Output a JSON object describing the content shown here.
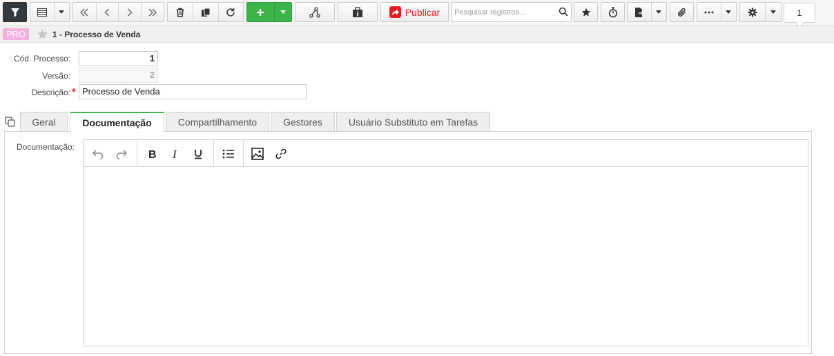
{
  "toolbar": {
    "publish_label": "Publicar",
    "search_placeholder": "Pesquisar registros...",
    "record_counter": "1",
    "icons": [
      "filter-icon",
      "grid-view-icon",
      "chevron-down-icon",
      "first-record-icon",
      "previous-record-icon",
      "next-record-icon",
      "last-record-icon",
      "delete-icon",
      "duplicate-icon",
      "refresh-icon",
      "plus-icon",
      "chevron-down-icon",
      "flowchart-icon",
      "info-card-icon",
      "publish-icon",
      "search-icon",
      "star-icon",
      "stopwatch-icon",
      "export-icon",
      "chevron-down-icon",
      "paperclip-icon",
      "more-icon",
      "chevron-down-icon",
      "gear-icon",
      "chevron-down-icon"
    ]
  },
  "breadcrumb": {
    "badge": "PRO",
    "title": "1 - Processo de Venda"
  },
  "form": {
    "code_label": "Cód. Processo:",
    "code_value": "1",
    "version_label": "Versão:",
    "version_value": "2",
    "description_label": "Descrição:",
    "description_required_mark": "*",
    "description_value": "Processo de Venda"
  },
  "tabs": [
    {
      "label": "Geral",
      "active": false
    },
    {
      "label": "Documentação",
      "active": true
    },
    {
      "label": "Compartilhamento",
      "active": false
    },
    {
      "label": "Gestores",
      "active": false
    },
    {
      "label": "Usuário Substituto em Tarefas",
      "active": false
    }
  ],
  "documentation": {
    "label": "Documentação:",
    "editor_tools": [
      "undo-icon",
      "redo-icon",
      "bold-icon",
      "italic-icon",
      "underline-icon",
      "bullet-list-icon",
      "image-icon",
      "link-icon"
    ],
    "content": ""
  },
  "colors": {
    "accent_green": "#3bb54a",
    "publish_red": "#e02020",
    "badge_pink": "#f3b1e0",
    "dark_button": "#333a40"
  }
}
